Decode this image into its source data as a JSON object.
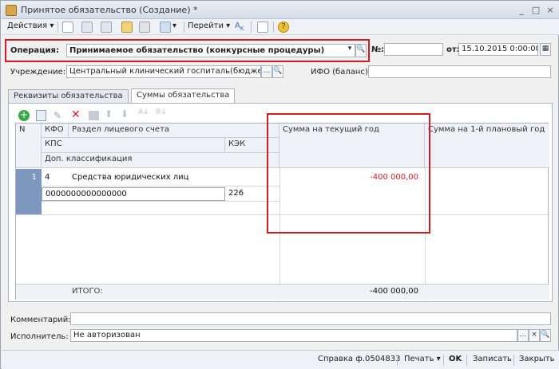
{
  "window": {
    "title": "Принятое обязательство (Создание) *",
    "controls": [
      "_",
      "□",
      "×"
    ]
  },
  "toolbar": {
    "actions_label": "Действия",
    "goto_label": "Перейти",
    "help_label": "?"
  },
  "form": {
    "operation_label": "Операция:",
    "operation_value": "Принимаемое обязательство (конкурсные процедуры)",
    "number_label": "№:",
    "number_value": "",
    "date_label": "от:",
    "date_value": "15.10.2015  0:00:00",
    "institution_label": "Учреждение:",
    "institution_value": "Центральный клинический госпиталь(бюджетное",
    "ifo_label": "ИФО (баланс):",
    "ifo_value": ""
  },
  "tabs": [
    {
      "label": "Реквизиты обязательства",
      "active": false
    },
    {
      "label": "Суммы обязательства",
      "active": true
    }
  ],
  "grid": {
    "headers": {
      "n": "N",
      "kfo": "КФО",
      "section": "Раздел лицевого счета",
      "kps": "КПС",
      "kek": "КЭК",
      "dop": "Доп. классификация",
      "sum_current": "Сумма на текущий год",
      "sum_plan1": "Сумма на 1-й плановый год"
    },
    "rows": [
      {
        "n": "1",
        "kfo": "4",
        "section": "Средства юридических лиц",
        "kps": "0000000000000000",
        "kek": "226",
        "sum_current": "-400 000,00"
      }
    ],
    "total_label": "ИТОГО:",
    "total_value": "-400 000,00"
  },
  "footer": {
    "comment_label": "Комментарий:",
    "comment_value": "",
    "executor_label": "Исполнитель:",
    "executor_value": "Не авторизован"
  },
  "statusbar": {
    "report_label": "Справка ф.0504833",
    "print_label": "Печать",
    "ok_label": "OK",
    "save_label": "Записать",
    "close_label": "Закрыть"
  },
  "colors": {
    "highlight": "#d11c24",
    "negative_value": "#d11c24",
    "row_marker": "#7d97bf"
  }
}
